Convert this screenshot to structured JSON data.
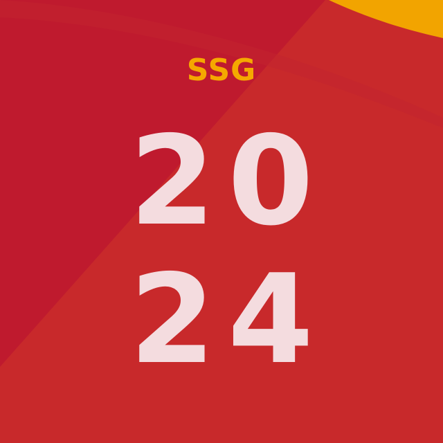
{
  "brand": {
    "text": "SSG",
    "color": "#f5a800"
  },
  "year": {
    "line1": "20",
    "line2": "24",
    "color": "#f4dcdf"
  },
  "background": {
    "base_color": "#bf1a2e",
    "overlay_color": "#c92a2a",
    "accent_color": "#f2a400"
  }
}
